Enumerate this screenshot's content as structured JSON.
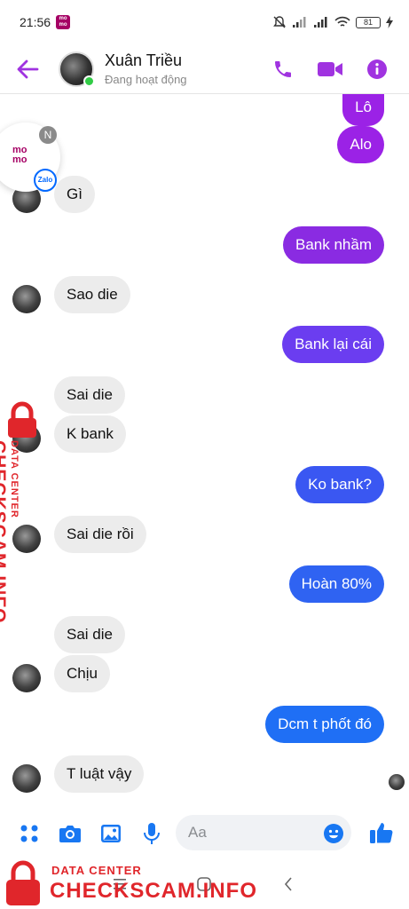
{
  "status_bar": {
    "time": "21:56",
    "battery": "81"
  },
  "header": {
    "name": "Xuân Triều",
    "status": "Đang hoạt động"
  },
  "chat_head": {
    "app": "momo",
    "badge": "N",
    "secondary_app": "Zalo"
  },
  "messages": [
    {
      "dir": "out",
      "text": "Lô",
      "color": "#9b22e6"
    },
    {
      "dir": "out",
      "text": "Alo",
      "color": "#9b22e6"
    },
    {
      "dir": "in",
      "text": "Gì"
    },
    {
      "dir": "out",
      "text": "Bank nhầm",
      "color": "#8a2be2"
    },
    {
      "dir": "in",
      "text": "Sao die"
    },
    {
      "dir": "out",
      "text": "Bank lại cái",
      "color": "#6b3df0"
    },
    {
      "dir": "in",
      "text": "Sai die"
    },
    {
      "dir": "in",
      "text": "K bank"
    },
    {
      "dir": "out",
      "text": "Ko bank?",
      "color": "#3a57f2"
    },
    {
      "dir": "in",
      "text": "Sai die rồi"
    },
    {
      "dir": "out",
      "text": "Hoàn 80%",
      "color": "#2f63f2"
    },
    {
      "dir": "in",
      "text": "Sai die"
    },
    {
      "dir": "in",
      "text": "Chịu"
    },
    {
      "dir": "out",
      "text": "Dcm t phốt đó",
      "color": "#1f6ff5"
    },
    {
      "dir": "in",
      "text": "T luật vậy"
    }
  ],
  "composer": {
    "placeholder": "Aa"
  },
  "watermark": {
    "small": "DATA CENTER",
    "big": "CHECKSCAM.INFO"
  },
  "colors": {
    "accent": "#a033e0",
    "composer_blue": "#1877f2",
    "watermark_red": "#e0262b"
  }
}
